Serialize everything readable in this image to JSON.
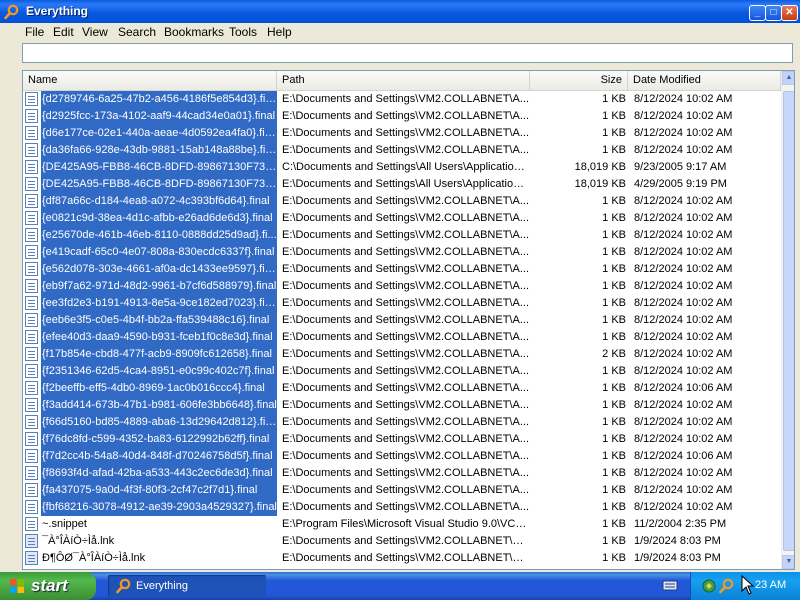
{
  "window": {
    "title": "Everything",
    "controls": [
      "_",
      "□",
      "✕"
    ]
  },
  "menu": [
    "File",
    "Edit",
    "View",
    "Search",
    "Bookmarks",
    "Tools",
    "Help"
  ],
  "search": {
    "value": "",
    "placeholder": ""
  },
  "columns": {
    "name": "Name",
    "path": "Path",
    "size": "Size",
    "date": "Date Modified"
  },
  "rows": [
    {
      "name": "{d2789746-6a25-47b2-a456-4186f5e854d3}.final",
      "path": "E:\\Documents and Settings\\VM2.COLLABNET\\A...",
      "size": "1 KB",
      "date": "8/12/2024 10:02 AM",
      "selected": true,
      "icon": "file-icon"
    },
    {
      "name": "{d2925fcc-173a-4102-aaf9-44cad34e0a01}.final",
      "path": "E:\\Documents and Settings\\VM2.COLLABNET\\A...",
      "size": "1 KB",
      "date": "8/12/2024 10:02 AM",
      "selected": true,
      "icon": "file-icon"
    },
    {
      "name": "{d6e177ce-02e1-440a-aeae-4d0592ea4fa0}.final",
      "path": "E:\\Documents and Settings\\VM2.COLLABNET\\A...",
      "size": "1 KB",
      "date": "8/12/2024 10:02 AM",
      "selected": true,
      "icon": "file-icon"
    },
    {
      "name": "{da36fa66-928e-43db-9881-15ab148a88be}.final",
      "path": "E:\\Documents and Settings\\VM2.COLLABNET\\A...",
      "size": "1 KB",
      "date": "8/12/2024 10:02 AM",
      "selected": true,
      "icon": "file-icon"
    },
    {
      "name": "{DE425A95-FBB8-46CB-8DFD-89867130F732...",
      "path": "C:\\Documents and Settings\\All Users\\Application ...",
      "size": "18,019 KB",
      "date": "9/23/2005 9:17 AM",
      "selected": true,
      "icon": "file-icon"
    },
    {
      "name": "{DE425A95-FBB8-46CB-8DFD-89867130F732...",
      "path": "E:\\Documents and Settings\\All Users\\Application ...",
      "size": "18,019 KB",
      "date": "4/29/2005 9:19 PM",
      "selected": true,
      "icon": "file-icon"
    },
    {
      "name": "{df87a66c-d184-4ea8-a072-4c393bf6d64}.final",
      "path": "E:\\Documents and Settings\\VM2.COLLABNET\\A...",
      "size": "1 KB",
      "date": "8/12/2024 10:02 AM",
      "selected": true,
      "icon": "file-icon"
    },
    {
      "name": "{e0821c9d-38ea-4d1c-afbb-e26ad6de6d3}.final",
      "path": "E:\\Documents and Settings\\VM2.COLLABNET\\A...",
      "size": "1 KB",
      "date": "8/12/2024 10:02 AM",
      "selected": true,
      "icon": "file-icon"
    },
    {
      "name": "{e25670de-461b-46eb-8110-0888dd25d9ad}.fi...",
      "path": "E:\\Documents and Settings\\VM2.COLLABNET\\A...",
      "size": "1 KB",
      "date": "8/12/2024 10:02 AM",
      "selected": true,
      "icon": "file-icon"
    },
    {
      "name": "{e419cadf-65c0-4e07-808a-830ecdc6337f}.final",
      "path": "E:\\Documents and Settings\\VM2.COLLABNET\\A...",
      "size": "1 KB",
      "date": "8/12/2024 10:02 AM",
      "selected": true,
      "icon": "file-icon"
    },
    {
      "name": "{e562d078-303e-4661-af0a-dc1433ee9597}.final",
      "path": "E:\\Documents and Settings\\VM2.COLLABNET\\A...",
      "size": "1 KB",
      "date": "8/12/2024 10:02 AM",
      "selected": true,
      "icon": "file-icon"
    },
    {
      "name": "{eb9f7a62-971d-48d2-9961-b7cf6d588979}.final",
      "path": "E:\\Documents and Settings\\VM2.COLLABNET\\A...",
      "size": "1 KB",
      "date": "8/12/2024 10:02 AM",
      "selected": true,
      "icon": "file-icon"
    },
    {
      "name": "{ee3fd2e3-b191-4913-8e5a-9ce182ed7023}.final",
      "path": "E:\\Documents and Settings\\VM2.COLLABNET\\A...",
      "size": "1 KB",
      "date": "8/12/2024 10:02 AM",
      "selected": true,
      "icon": "file-icon"
    },
    {
      "name": "{eeb6e3f5-c0e5-4b4f-bb2a-ffa539488c16}.final",
      "path": "E:\\Documents and Settings\\VM2.COLLABNET\\A...",
      "size": "1 KB",
      "date": "8/12/2024 10:02 AM",
      "selected": true,
      "icon": "file-icon"
    },
    {
      "name": "{efee40d3-daa9-4590-b931-fceb1f0c8e3d}.final",
      "path": "E:\\Documents and Settings\\VM2.COLLABNET\\A...",
      "size": "1 KB",
      "date": "8/12/2024 10:02 AM",
      "selected": true,
      "icon": "file-icon"
    },
    {
      "name": "{f17b854e-cbd8-477f-acb9-8909fc612658}.final",
      "path": "E:\\Documents and Settings\\VM2.COLLABNET\\A...",
      "size": "2 KB",
      "date": "8/12/2024 10:02 AM",
      "selected": true,
      "icon": "file-icon"
    },
    {
      "name": "{f2351346-62d5-4ca4-8951-e0c99c402c7f}.final",
      "path": "E:\\Documents and Settings\\VM2.COLLABNET\\A...",
      "size": "1 KB",
      "date": "8/12/2024 10:02 AM",
      "selected": true,
      "icon": "file-icon"
    },
    {
      "name": "{f2beeffb-eff5-4db0-8969-1ac0b016ccc4}.final",
      "path": "E:\\Documents and Settings\\VM2.COLLABNET\\A...",
      "size": "1 KB",
      "date": "8/12/2024 10:06 AM",
      "selected": true,
      "icon": "file-icon"
    },
    {
      "name": "{f3add414-673b-47b1-b981-606fe3bb6648}.final",
      "path": "E:\\Documents and Settings\\VM2.COLLABNET\\A...",
      "size": "1 KB",
      "date": "8/12/2024 10:02 AM",
      "selected": true,
      "icon": "file-icon"
    },
    {
      "name": "{f66d5160-bd85-4889-aba6-13d29642d812}.final",
      "path": "E:\\Documents and Settings\\VM2.COLLABNET\\A...",
      "size": "1 KB",
      "date": "8/12/2024 10:02 AM",
      "selected": true,
      "icon": "file-icon"
    },
    {
      "name": "{f76dc8fd-c599-4352-ba83-6122992b62ff}.final",
      "path": "E:\\Documents and Settings\\VM2.COLLABNET\\A...",
      "size": "1 KB",
      "date": "8/12/2024 10:02 AM",
      "selected": true,
      "icon": "file-icon"
    },
    {
      "name": "{f7d2cc4b-54a8-40d4-848f-d70246758d5f}.final",
      "path": "E:\\Documents and Settings\\VM2.COLLABNET\\A...",
      "size": "1 KB",
      "date": "8/12/2024 10:06 AM",
      "selected": true,
      "icon": "file-icon"
    },
    {
      "name": "{f8693f4d-afad-42ba-a533-443c2ec6de3d}.final",
      "path": "E:\\Documents and Settings\\VM2.COLLABNET\\A...",
      "size": "1 KB",
      "date": "8/12/2024 10:02 AM",
      "selected": true,
      "icon": "file-icon"
    },
    {
      "name": "{fa437075-9a0d-4f3f-80f3-2cf47c2f7d1}.final",
      "path": "E:\\Documents and Settings\\VM2.COLLABNET\\A...",
      "size": "1 KB",
      "date": "8/12/2024 10:02 AM",
      "selected": true,
      "icon": "file-icon"
    },
    {
      "name": "{fbf68216-3078-4912-ae39-2903a4529327}.final",
      "path": "E:\\Documents and Settings\\VM2.COLLABNET\\A...",
      "size": "1 KB",
      "date": "8/12/2024 10:02 AM",
      "selected": true,
      "icon": "file-icon"
    },
    {
      "name": "~.snippet",
      "path": "E:\\Program Files\\Microsoft Visual Studio 9.0\\VC#\\...",
      "size": "1 KB",
      "date": "11/2/2004 2:35 PM",
      "selected": false,
      "icon": "snippet-file-icon"
    },
    {
      "name": "¯À°ÎÀíÒ÷Ìå.lnk",
      "path": "E:\\Documents and Settings\\VM2.COLLABNET\\St...",
      "size": "1 KB",
      "date": "1/9/2024 8:03 PM",
      "selected": false,
      "icon": "shortcut-icon"
    },
    {
      "name": "Ð¶ÔØ¯À°ÎÀíÒ÷Ìå.lnk",
      "path": "E:\\Documents and Settings\\VM2.COLLABNET\\St...",
      "size": "1 KB",
      "date": "1/9/2024 8:03 PM",
      "selected": false,
      "icon": "shortcut-icon"
    }
  ],
  "taskbar": {
    "start_label": "start",
    "task_label": "Everything",
    "clock": "23 AM"
  },
  "colors": {
    "selection": "#316ac5",
    "titlebar": "#0a5ae0",
    "taskbar": "#2157d7",
    "start": "#3c9a3c"
  }
}
